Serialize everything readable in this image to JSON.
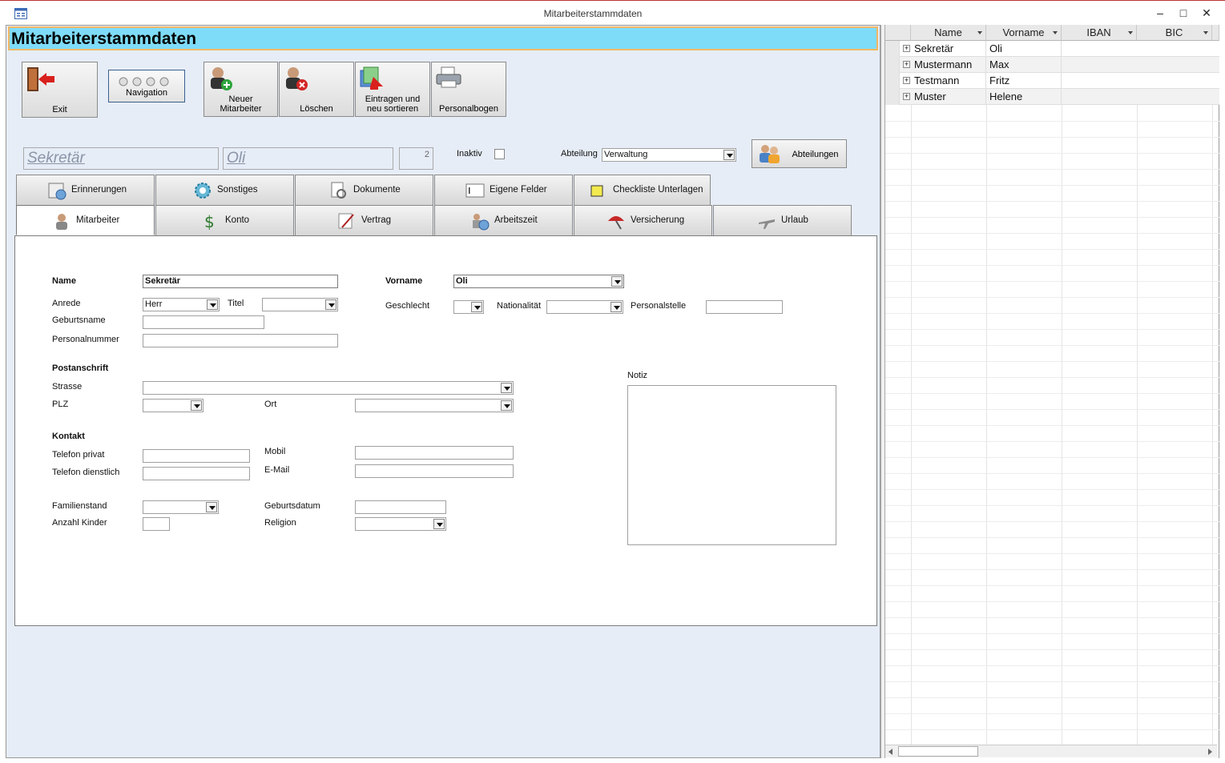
{
  "window": {
    "title": "Mitarbeiterstammdaten",
    "minimize": "–",
    "maximize": "□",
    "close": "✕"
  },
  "form": {
    "header": "Mitarbeiterstammdaten",
    "toolbar": {
      "exit": "Exit",
      "navigation": "Navigation",
      "neuer_line1": "Neuer",
      "neuer_line2": "Mitarbeiter",
      "loeschen": "Löschen",
      "eintragen_line1": "Eintragen und",
      "eintragen_line2": "neu sortieren",
      "personalbogen": "Personalbogen"
    },
    "record": {
      "name": "Sekretär",
      "vorname": "Oli",
      "id": "2",
      "inaktiv_label": "Inaktiv",
      "abteilung_label": "Abteilung",
      "abteilung_value": "Verwaltung",
      "abteilungen_button": "Abteilungen"
    },
    "tabs_row1": [
      "Erinnerungen",
      "Sonstiges",
      "Dokumente",
      "Eigene Felder",
      "Checkliste Unterlagen"
    ],
    "tabs_row2": [
      "Mitarbeiter",
      "Konto",
      "Vertrag",
      "Arbeitszeit",
      "Versicherung",
      "Urlaub"
    ],
    "fields": {
      "name_label": "Name",
      "name_value": "Sekretär",
      "vorname_label": "Vorname",
      "vorname_value": "Oli",
      "anrede_label": "Anrede",
      "anrede_value": "Herr",
      "titel_label": "Titel",
      "titel_value": "",
      "geschlecht_label": "Geschlecht",
      "nationalitaet_label": "Nationalität",
      "personalstelle_label": "Personalstelle",
      "geburtsname_label": "Geburtsname",
      "personalnummer_label": "Personalnummer",
      "postanschrift_label": "Postanschrift",
      "strasse_label": "Strasse",
      "plz_label": "PLZ",
      "ort_label": "Ort",
      "notiz_label": "Notiz",
      "kontakt_label": "Kontakt",
      "tel_privat_label": "Telefon privat",
      "tel_dienst_label": "Telefon dienstlich",
      "mobil_label": "Mobil",
      "email_label": "E-Mail",
      "familienstand_label": "Familienstand",
      "kinder_label": "Anzahl Kinder",
      "geburtsdatum_label": "Geburtsdatum",
      "religion_label": "Religion"
    }
  },
  "datasheet": {
    "columns": [
      "Name",
      "Vorname",
      "IBAN",
      "BIC"
    ],
    "rows": [
      {
        "name": "Sekretär",
        "vorname": "Oli"
      },
      {
        "name": "Mustermann",
        "vorname": "Max"
      },
      {
        "name": "Testmann",
        "vorname": "Fritz"
      },
      {
        "name": "Muster",
        "vorname": "Helene"
      }
    ]
  },
  "colors": {
    "header_bg": "#7fdcf9",
    "header_border": "#f2b765",
    "form_bg": "#e6edf7"
  }
}
